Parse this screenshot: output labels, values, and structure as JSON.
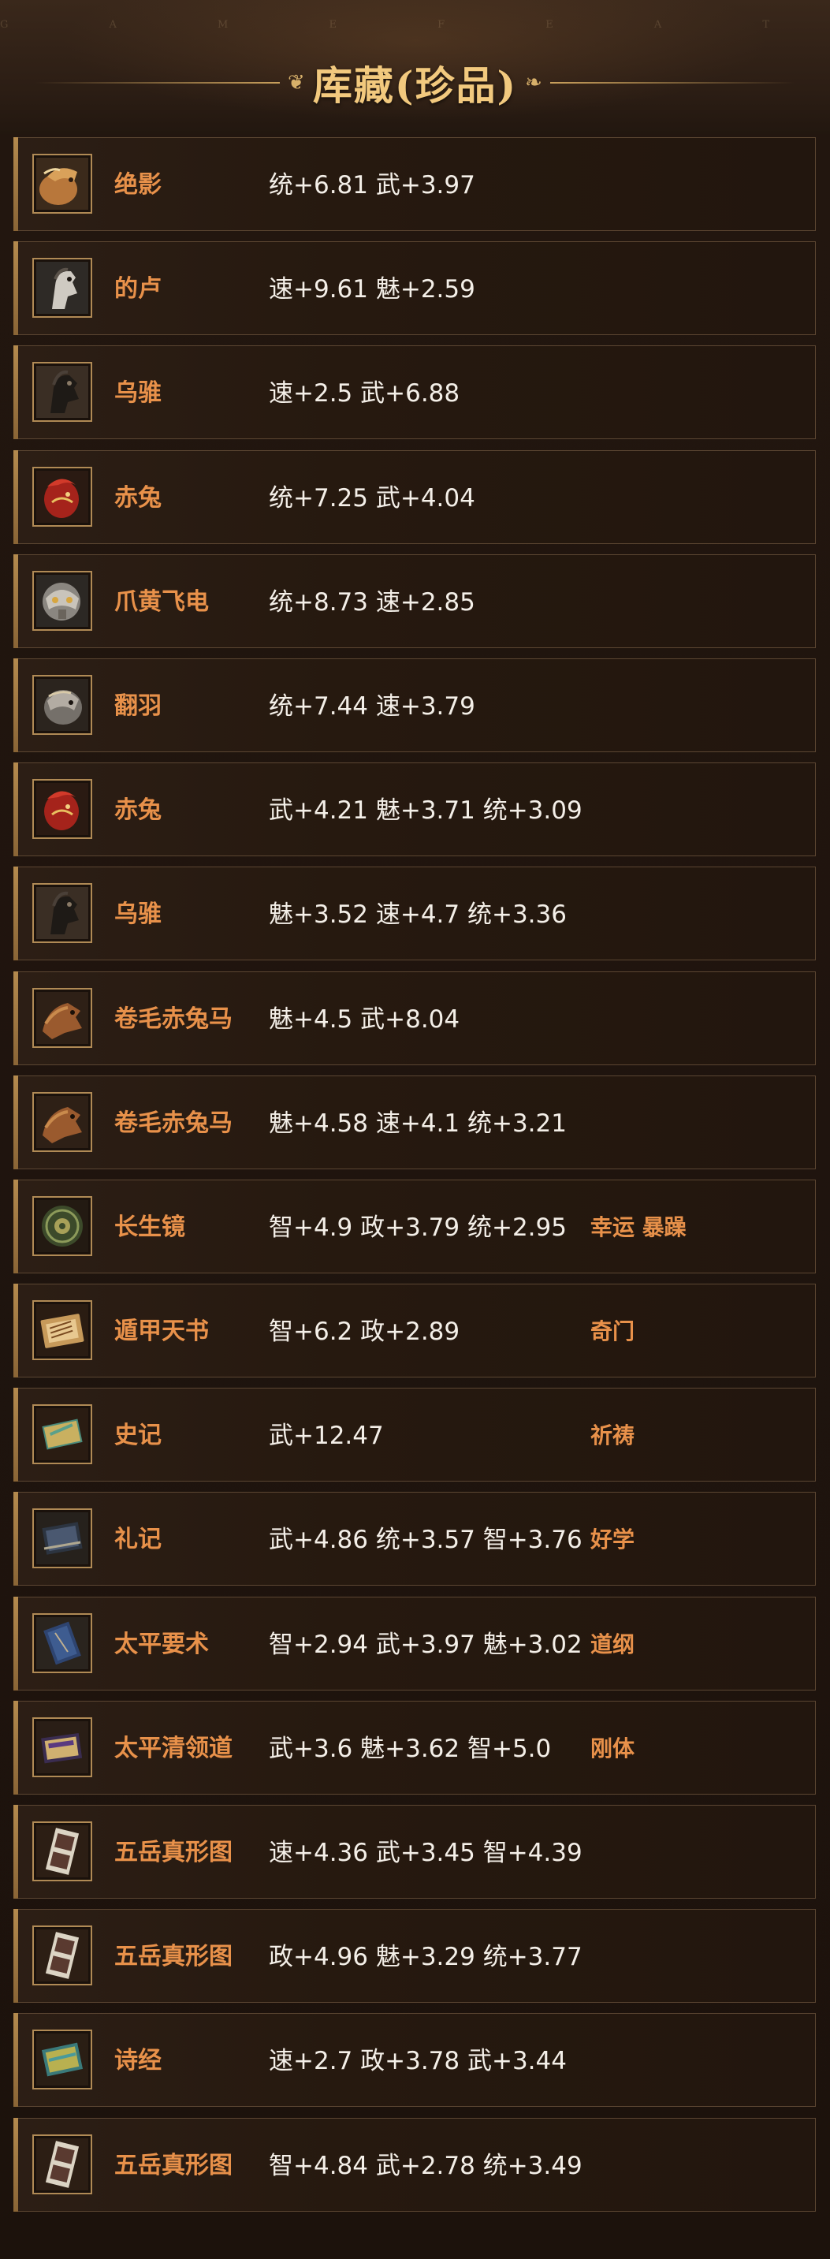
{
  "header": {
    "subtitle": "G A M E   F E A T U R E S",
    "title": "库藏(珍品)",
    "deco_left": "❦",
    "deco_right": "❧"
  },
  "colors": {
    "name": "#e8914a",
    "stats": "#f4efe8",
    "title": "#f2c97e",
    "border": "#5c4632"
  },
  "items": [
    {
      "name": "绝影",
      "stats": "统+6.81 武+3.97",
      "skill": "",
      "icon": "horse-chestnut-icon"
    },
    {
      "name": "的卢",
      "stats": "速+9.61 魅+2.59",
      "skill": "",
      "icon": "horse-white-icon"
    },
    {
      "name": "乌骓",
      "stats": "速+2.5 武+6.88",
      "skill": "",
      "icon": "horse-black-icon"
    },
    {
      "name": "赤兔",
      "stats": "统+7.25 武+4.04",
      "skill": "",
      "icon": "horse-red-icon"
    },
    {
      "name": "爪黄飞电",
      "stats": "统+8.73 速+2.85",
      "skill": "",
      "icon": "horse-armored-icon"
    },
    {
      "name": "翻羽",
      "stats": "统+7.44 速+3.79",
      "skill": "",
      "icon": "horse-grey-icon"
    },
    {
      "name": "赤兔",
      "stats": "武+4.21 魅+3.71 统+3.09",
      "skill": "",
      "icon": "horse-red-icon"
    },
    {
      "name": "乌骓",
      "stats": "魅+3.52 速+4.7 统+3.36",
      "skill": "",
      "icon": "horse-black-icon"
    },
    {
      "name": "卷毛赤兔马",
      "stats": "魅+4.5 武+8.04",
      "skill": "",
      "icon": "horse-brown-icon"
    },
    {
      "name": "卷毛赤兔马",
      "stats": "魅+4.58 速+4.1 统+3.21",
      "skill": "",
      "icon": "horse-brown-icon"
    },
    {
      "name": "长生镜",
      "stats": "智+4.9 政+3.79 统+2.95",
      "skill": "幸运 暴躁",
      "icon": "mirror-icon"
    },
    {
      "name": "遁甲天书",
      "stats": "智+6.2 政+2.89",
      "skill": "奇门",
      "icon": "scroll-book-icon"
    },
    {
      "name": "史记",
      "stats": "武+12.47",
      "skill": "祈祷",
      "icon": "green-book-icon"
    },
    {
      "name": "礼记",
      "stats": "武+4.86 统+3.57 智+3.76",
      "skill": "好学",
      "icon": "dark-book-icon"
    },
    {
      "name": "太平要术",
      "stats": "智+2.94 武+3.97 魅+3.02",
      "skill": "道纲",
      "icon": "blue-book-icon"
    },
    {
      "name": "太平清领道",
      "stats": "武+3.6 魅+3.62 智+5.0",
      "skill": "刚体",
      "icon": "purple-book-icon"
    },
    {
      "name": "五岳真形图",
      "stats": "速+4.36 武+3.45 智+4.39",
      "skill": "",
      "icon": "talisman-map-icon"
    },
    {
      "name": "五岳真形图",
      "stats": "政+4.96 魅+3.29 统+3.77",
      "skill": "",
      "icon": "talisman-map-icon"
    },
    {
      "name": "诗经",
      "stats": "速+2.7 政+3.78 武+3.44",
      "skill": "",
      "icon": "teal-book-icon"
    },
    {
      "name": "五岳真形图",
      "stats": "智+4.84 武+2.78 统+3.49",
      "skill": "",
      "icon": "talisman-map-icon"
    }
  ]
}
